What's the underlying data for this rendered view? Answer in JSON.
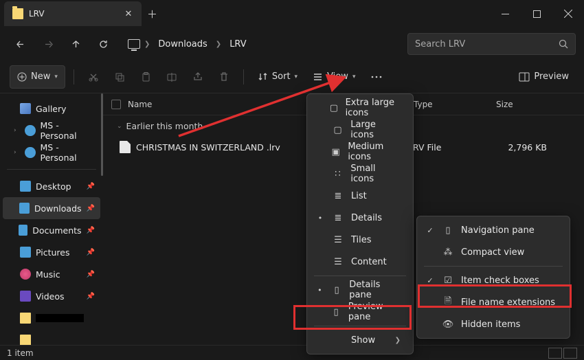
{
  "window": {
    "tab_title": "LRV"
  },
  "addr": {
    "crumb1": "Downloads",
    "crumb2": "LRV",
    "search_placeholder": "Search LRV"
  },
  "toolbar": {
    "new": "New",
    "sort": "Sort",
    "view": "View",
    "preview": "Preview"
  },
  "sidebar": {
    "gallery": "Gallery",
    "ms1": "MS - Personal",
    "ms2": "MS - Personal",
    "desktop": "Desktop",
    "downloads": "Downloads",
    "documents": "Documents",
    "pictures": "Pictures",
    "music": "Music",
    "videos": "Videos"
  },
  "columns": {
    "name": "Name",
    "type": "Type",
    "size": "Size"
  },
  "group_header": "Earlier this month",
  "files": [
    {
      "name": "CHRISTMAS IN SWITZERLAND .lrv",
      "type": "LRV File",
      "size": "2,796 KB"
    }
  ],
  "view_menu": {
    "xl": "Extra large icons",
    "lg": "Large icons",
    "md": "Medium icons",
    "sm": "Small icons",
    "list": "List",
    "details": "Details",
    "tiles": "Tiles",
    "content": "Content",
    "details_pane": "Details pane",
    "preview_pane": "Preview pane",
    "show": "Show"
  },
  "show_menu": {
    "nav": "Navigation pane",
    "compact": "Compact view",
    "checks": "Item check boxes",
    "ext": "File name extensions",
    "hidden": "Hidden items"
  },
  "status": {
    "count": "1 item"
  }
}
